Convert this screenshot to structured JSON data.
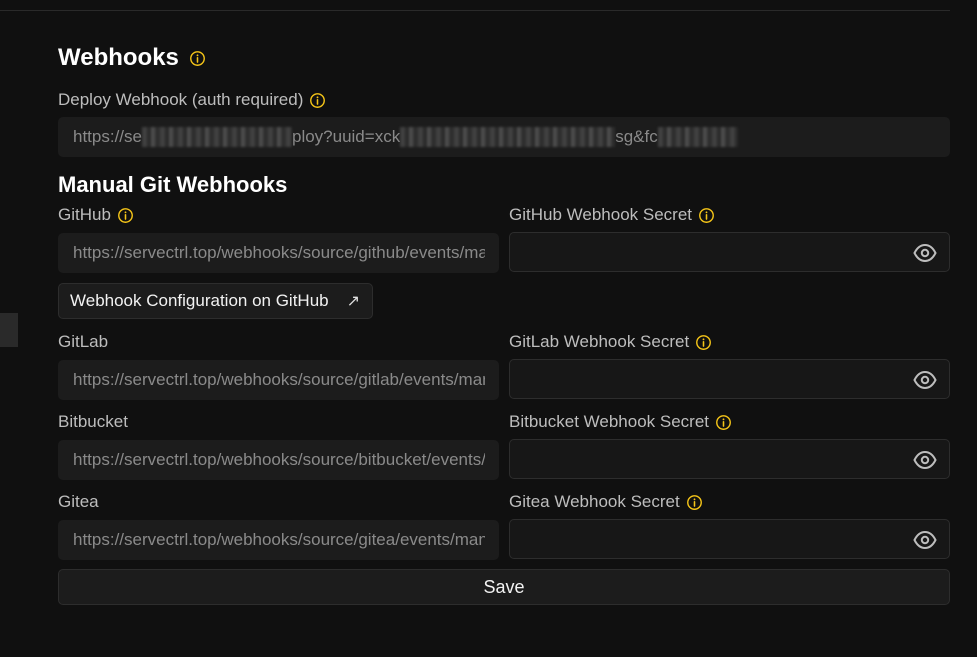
{
  "webhooks": {
    "title": "Webhooks",
    "deploy_label": "Deploy Webhook (auth required)",
    "deploy_value_prefix": "https://se",
    "deploy_value_mid1": "ploy?uuid=xck",
    "deploy_value_mid2": "sg&fc"
  },
  "manual": {
    "title": "Manual Git Webhooks",
    "github": {
      "label": "GitHub",
      "url": "https://servectrl.top/webhooks/source/github/events/manual",
      "secret_label": "GitHub Webhook Secret",
      "secret_value": "",
      "config_button": "Webhook Configuration on GitHub",
      "config_arrow": "↗"
    },
    "gitlab": {
      "label": "GitLab",
      "url": "https://servectrl.top/webhooks/source/gitlab/events/manual",
      "secret_label": "GitLab Webhook Secret",
      "secret_value": ""
    },
    "bitbucket": {
      "label": "Bitbucket",
      "url": "https://servectrl.top/webhooks/source/bitbucket/events/manual",
      "secret_label": "Bitbucket Webhook Secret",
      "secret_value": ""
    },
    "gitea": {
      "label": "Gitea",
      "url": "https://servectrl.top/webhooks/source/gitea/events/manual",
      "secret_label": "Gitea Webhook Secret",
      "secret_value": ""
    }
  },
  "actions": {
    "save_label": "Save"
  },
  "colors": {
    "accent_info": "#f5c518",
    "background": "#101010",
    "field": "#1c1c1c"
  },
  "icons": {
    "info": "info-circle-icon",
    "eye": "eye-icon",
    "external": "external-link-arrow-icon"
  }
}
